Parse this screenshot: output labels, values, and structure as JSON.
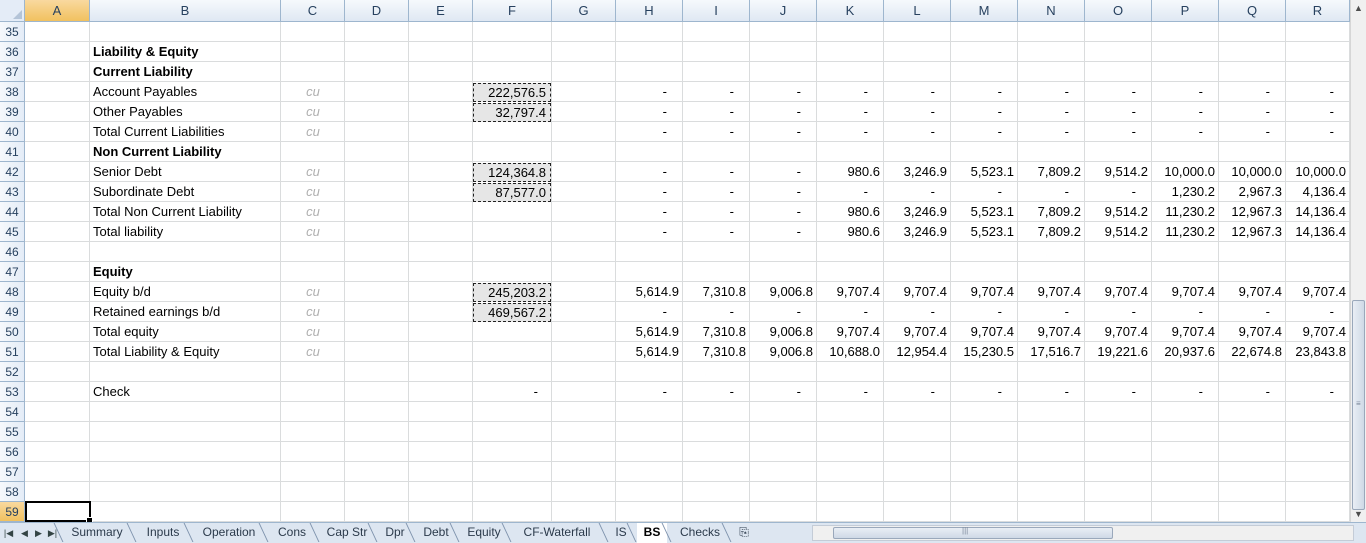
{
  "columns": [
    "A",
    "B",
    "C",
    "D",
    "E",
    "F",
    "G",
    "H",
    "I",
    "J",
    "K",
    "L",
    "M",
    "N",
    "O",
    "P",
    "Q",
    "R"
  ],
  "selected_column": "A",
  "rows": [
    "35",
    "36",
    "37",
    "38",
    "39",
    "40",
    "41",
    "42",
    "43",
    "44",
    "45",
    "46",
    "47",
    "48",
    "49",
    "50",
    "51",
    "52",
    "53",
    "54",
    "55",
    "56",
    "57",
    "58",
    "59"
  ],
  "selected_row": "59",
  "sheet": [
    {
      "row": "35"
    },
    {
      "row": "36",
      "label": "Liability & Equity",
      "bold": true
    },
    {
      "row": "37",
      "label": "Current Liability",
      "bold": true
    },
    {
      "row": "38",
      "label": "Account Payables",
      "unit": "cu",
      "input": "222,576.5",
      "values": [
        "-",
        "-",
        "-",
        "-",
        "-",
        "-",
        "-",
        "-",
        "-",
        "-",
        "-"
      ]
    },
    {
      "row": "39",
      "label": "Other Payables",
      "unit": "cu",
      "input": "32,797.4",
      "values": [
        "-",
        "-",
        "-",
        "-",
        "-",
        "-",
        "-",
        "-",
        "-",
        "-",
        "-"
      ]
    },
    {
      "row": "40",
      "label": "Total Current Liabilities",
      "unit": "cu",
      "values": [
        "-",
        "-",
        "-",
        "-",
        "-",
        "-",
        "-",
        "-",
        "-",
        "-",
        "-"
      ]
    },
    {
      "row": "41",
      "label": "Non Current Liability",
      "bold": true
    },
    {
      "row": "42",
      "label": "Senior Debt",
      "unit": "cu",
      "input": "124,364.8",
      "values": [
        "-",
        "-",
        "-",
        "980.6",
        "3,246.9",
        "5,523.1",
        "7,809.2",
        "9,514.2",
        "10,000.0",
        "10,000.0",
        "10,000.0"
      ]
    },
    {
      "row": "43",
      "label": "Subordinate Debt",
      "unit": "cu",
      "input": "87,577.0",
      "values": [
        "-",
        "-",
        "-",
        "-",
        "-",
        "-",
        "-",
        "-",
        "1,230.2",
        "2,967.3",
        "4,136.4"
      ]
    },
    {
      "row": "44",
      "label": "Total Non Current Liability",
      "unit": "cu",
      "values": [
        "-",
        "-",
        "-",
        "980.6",
        "3,246.9",
        "5,523.1",
        "7,809.2",
        "9,514.2",
        "11,230.2",
        "12,967.3",
        "14,136.4"
      ]
    },
    {
      "row": "45",
      "label": "Total liability",
      "unit": "cu",
      "values": [
        "-",
        "-",
        "-",
        "980.6",
        "3,246.9",
        "5,523.1",
        "7,809.2",
        "9,514.2",
        "11,230.2",
        "12,967.3",
        "14,136.4"
      ]
    },
    {
      "row": "46"
    },
    {
      "row": "47",
      "label": "Equity",
      "bold": true
    },
    {
      "row": "48",
      "label": "Equity b/d",
      "unit": "cu",
      "input": "245,203.2",
      "values": [
        "5,614.9",
        "7,310.8",
        "9,006.8",
        "9,707.4",
        "9,707.4",
        "9,707.4",
        "9,707.4",
        "9,707.4",
        "9,707.4",
        "9,707.4",
        "9,707.4"
      ]
    },
    {
      "row": "49",
      "label": "Retained earnings b/d",
      "unit": "cu",
      "input": "469,567.2",
      "values": [
        "-",
        "-",
        "-",
        "-",
        "-",
        "-",
        "-",
        "-",
        "-",
        "-",
        "-"
      ]
    },
    {
      "row": "50",
      "label": "Total equity",
      "unit": "cu",
      "values": [
        "5,614.9",
        "7,310.8",
        "9,006.8",
        "9,707.4",
        "9,707.4",
        "9,707.4",
        "9,707.4",
        "9,707.4",
        "9,707.4",
        "9,707.4",
        "9,707.4"
      ]
    },
    {
      "row": "51",
      "label": "Total Liability & Equity",
      "unit": "cu",
      "values": [
        "5,614.9",
        "7,310.8",
        "9,006.8",
        "10,688.0",
        "12,954.4",
        "15,230.5",
        "17,516.7",
        "19,221.6",
        "20,937.6",
        "22,674.8",
        "23,843.8"
      ]
    },
    {
      "row": "52"
    },
    {
      "row": "53",
      "label": "Check",
      "fval": "-",
      "values": [
        "-",
        "-",
        "-",
        "-",
        "-",
        "-",
        "-",
        "-",
        "-",
        "-",
        "-"
      ]
    },
    {
      "row": "54"
    },
    {
      "row": "55"
    },
    {
      "row": "56"
    },
    {
      "row": "57"
    },
    {
      "row": "58"
    },
    {
      "row": "59"
    }
  ],
  "tabs": [
    "Summary",
    "Inputs",
    "Operation",
    "Cons",
    "Cap Str",
    "Dpr",
    "Debt",
    "Equity",
    "CF-Waterfall",
    "IS",
    "BS",
    "Checks"
  ],
  "active_tab": "BS",
  "icons": {
    "new_sheet": "insert-sheet-icon",
    "first": "first-sheet-icon",
    "prev": "prev-sheet-icon",
    "next": "next-sheet-icon",
    "last": "last-sheet-icon"
  }
}
